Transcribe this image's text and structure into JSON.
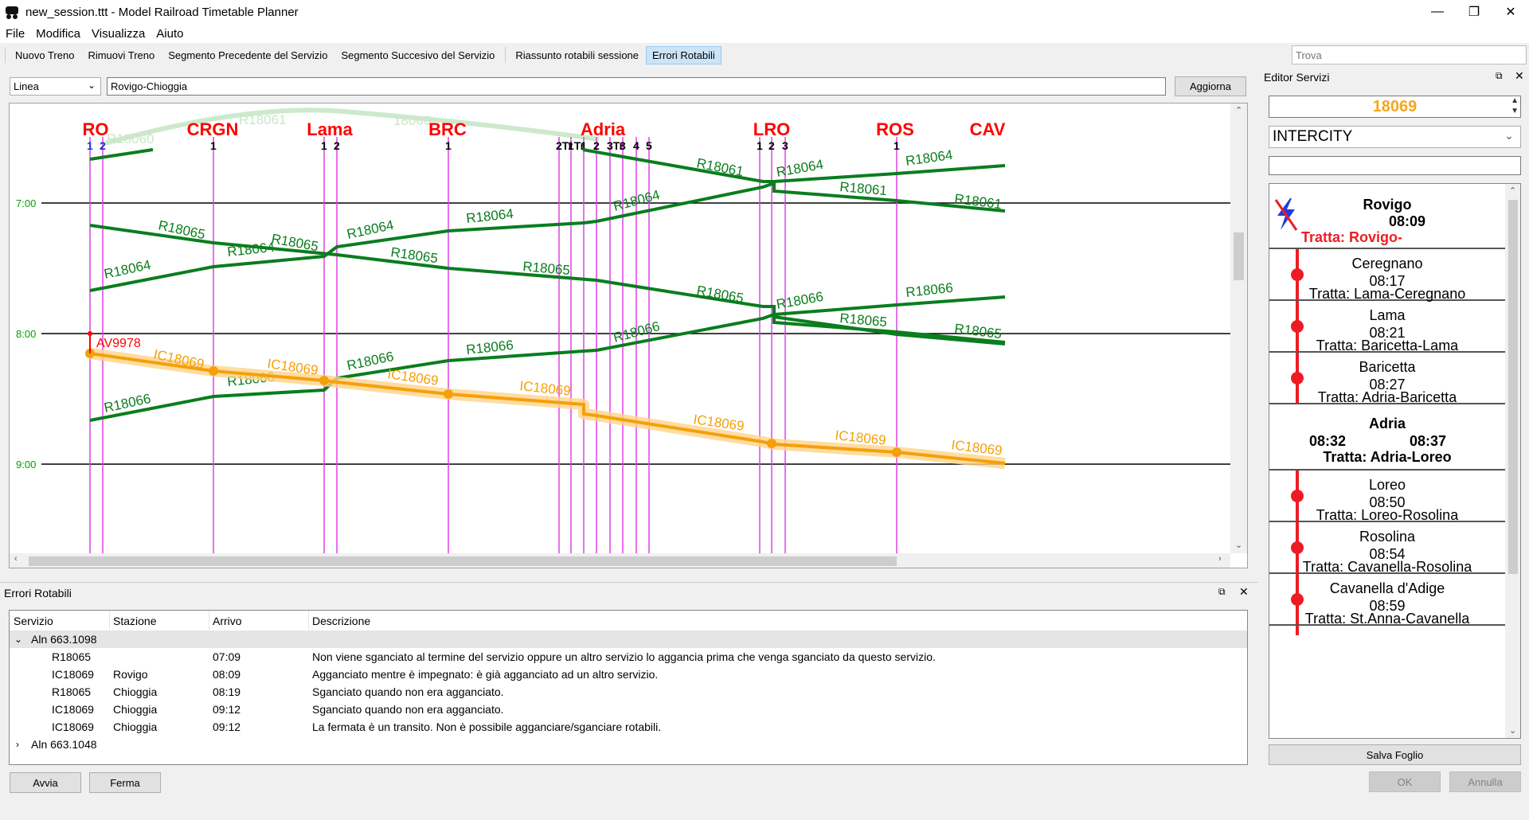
{
  "window": {
    "title": "new_session.ttt - Model Railroad Timetable Planner",
    "minimize": "—",
    "maximize": "❐",
    "close": "✕"
  },
  "menu": [
    "File",
    "Modifica",
    "Visualizza",
    "Aiuto"
  ],
  "toolbar": {
    "buttons": [
      "Nuovo Treno",
      "Rimuovi Treno",
      "Segmento Precedente del Servizio",
      "Segmento Succesivo del Servizio",
      "Riassunto rotabili sessione",
      "Errori Rotabili"
    ],
    "search_placeholder": "Trova"
  },
  "graph_controls": {
    "mode": "Linea",
    "line": "Rovigo-Chioggia",
    "refresh": "Aggiorna"
  },
  "graph": {
    "stations": [
      {
        "code": "RO",
        "platforms": [
          "1",
          "2"
        ]
      },
      {
        "code": "CRGN",
        "platforms": [
          "1"
        ]
      },
      {
        "code": "Lama",
        "platforms": [
          "1",
          "2"
        ]
      },
      {
        "code": "BRC",
        "platforms": [
          "1"
        ]
      },
      {
        "code": "Adria",
        "platforms": [
          "2Tr",
          "1Tr",
          "1",
          "2",
          "3Tr",
          "3",
          "4",
          "5"
        ]
      },
      {
        "code": "LRO",
        "platforms": [
          "1",
          "2",
          "3"
        ]
      },
      {
        "code": "ROS",
        "platforms": [
          "1"
        ]
      },
      {
        "code": "CAV",
        "platforms": []
      }
    ],
    "hours": [
      "7:00",
      "8:00",
      "9:00"
    ],
    "trains": [
      "R18060",
      "R18061",
      "R18064",
      "R18065",
      "R18066",
      "IC18069",
      "AV9978"
    ],
    "selected_train": "IC18069",
    "faded_labels": [
      "R18060",
      "R18061",
      "18060"
    ]
  },
  "errors": {
    "title": "Errori Rotabili",
    "columns": [
      "Servizio",
      "Stazione",
      "Arrivo",
      "Descrizione"
    ],
    "groups": [
      {
        "name": "Aln 663.1098",
        "expanded": true,
        "rows": [
          {
            "servizio": "R18065",
            "stazione": "",
            "arrivo": "07:09",
            "descrizione": "Non viene sganciato al termine del servizio oppure un altro servizio lo aggancia prima che venga sganciato da questo servizio."
          },
          {
            "servizio": "IC18069",
            "stazione": "Rovigo",
            "arrivo": "08:09",
            "descrizione": "Agganciato mentre è impegnato: è già agganciato ad un altro servizio."
          },
          {
            "servizio": "R18065",
            "stazione": "Chioggia",
            "arrivo": "08:19",
            "descrizione": "Sganciato quando non era agganciato."
          },
          {
            "servizio": "IC18069",
            "stazione": "Chioggia",
            "arrivo": "09:12",
            "descrizione": "Sganciato quando non era agganciato."
          },
          {
            "servizio": "IC18069",
            "stazione": "Chioggia",
            "arrivo": "09:12",
            "descrizione": "La fermata è un transito. Non è possibile agganciare/sganciare rotabili."
          }
        ]
      },
      {
        "name": "Aln 663.1048",
        "expanded": false,
        "rows": []
      }
    ],
    "start": "Avvia",
    "stop": "Ferma"
  },
  "editor": {
    "title": "Editor Servizi",
    "service_number": "18069",
    "service_type": "INTERCITY",
    "stops": [
      {
        "name": "Rovigo",
        "time": "08:09",
        "tratta": "Tratta: Rovigo-",
        "first": true
      },
      {
        "name": "Ceregnano",
        "time": "08:17",
        "tratta": "Tratta: Lama-Ceregnano"
      },
      {
        "name": "Lama",
        "time": "08:21",
        "tratta": "Tratta: Baricetta-Lama"
      },
      {
        "name": "Baricetta",
        "time": "08:27",
        "tratta": "Tratta: Adria-Baricetta"
      },
      {
        "name": "Adria",
        "arrival": "08:32",
        "departure": "08:37",
        "tratta": "Tratta: Adria-Loreo",
        "bold": true
      },
      {
        "name": "Loreo",
        "time": "08:50",
        "tratta": "Tratta: Loreo-Rosolina"
      },
      {
        "name": "Rosolina",
        "time": "08:54",
        "tratta": "Tratta: Cavanella-Rosolina"
      },
      {
        "name": "Cavanella d'Adige",
        "time": "08:59",
        "tratta": "Tratta: St.Anna-Cavanella"
      }
    ],
    "save": "Salva Foglio",
    "ok": "OK",
    "cancel": "Annulla"
  },
  "colors": {
    "regional": "#0a7d1e",
    "intercity": "#f5a00a",
    "station_text": "#ff0000",
    "platform_line": "#e040e8",
    "error_train": "#ff0000"
  }
}
